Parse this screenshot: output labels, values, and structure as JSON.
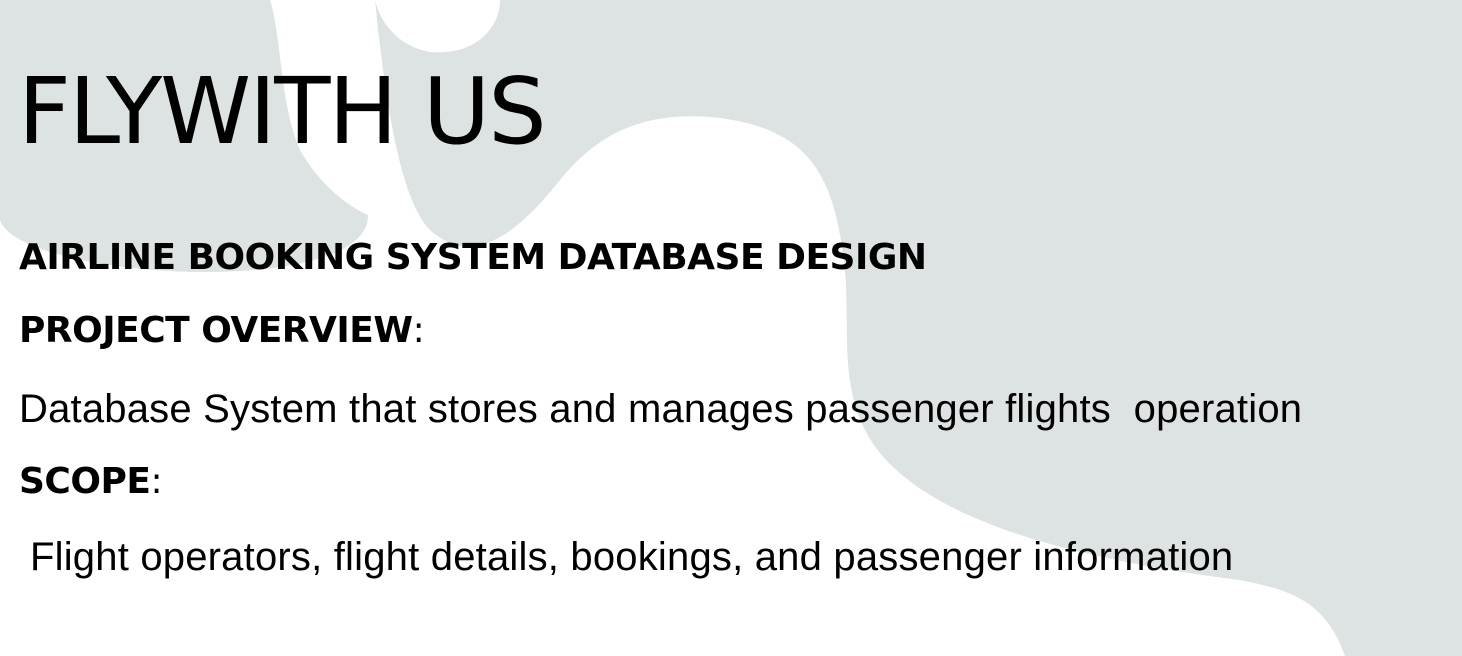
{
  "slide": {
    "title": "FLYWITH US",
    "subtitle": "AIRLINE BOOKING SYSTEM DATABASE DESIGN",
    "overview_heading": "PROJECT OVERVIEW",
    "overview_colon": ":",
    "overview_text": "Database System that stores and manages passenger flights  operation",
    "scope_heading": "SCOPE",
    "scope_colon": ":",
    "scope_text": "Flight operators, flight details, bookings, and passenger information"
  },
  "colors": {
    "background": "#ffffff",
    "shape_fill": "#dde2e2",
    "text": "#000000"
  }
}
